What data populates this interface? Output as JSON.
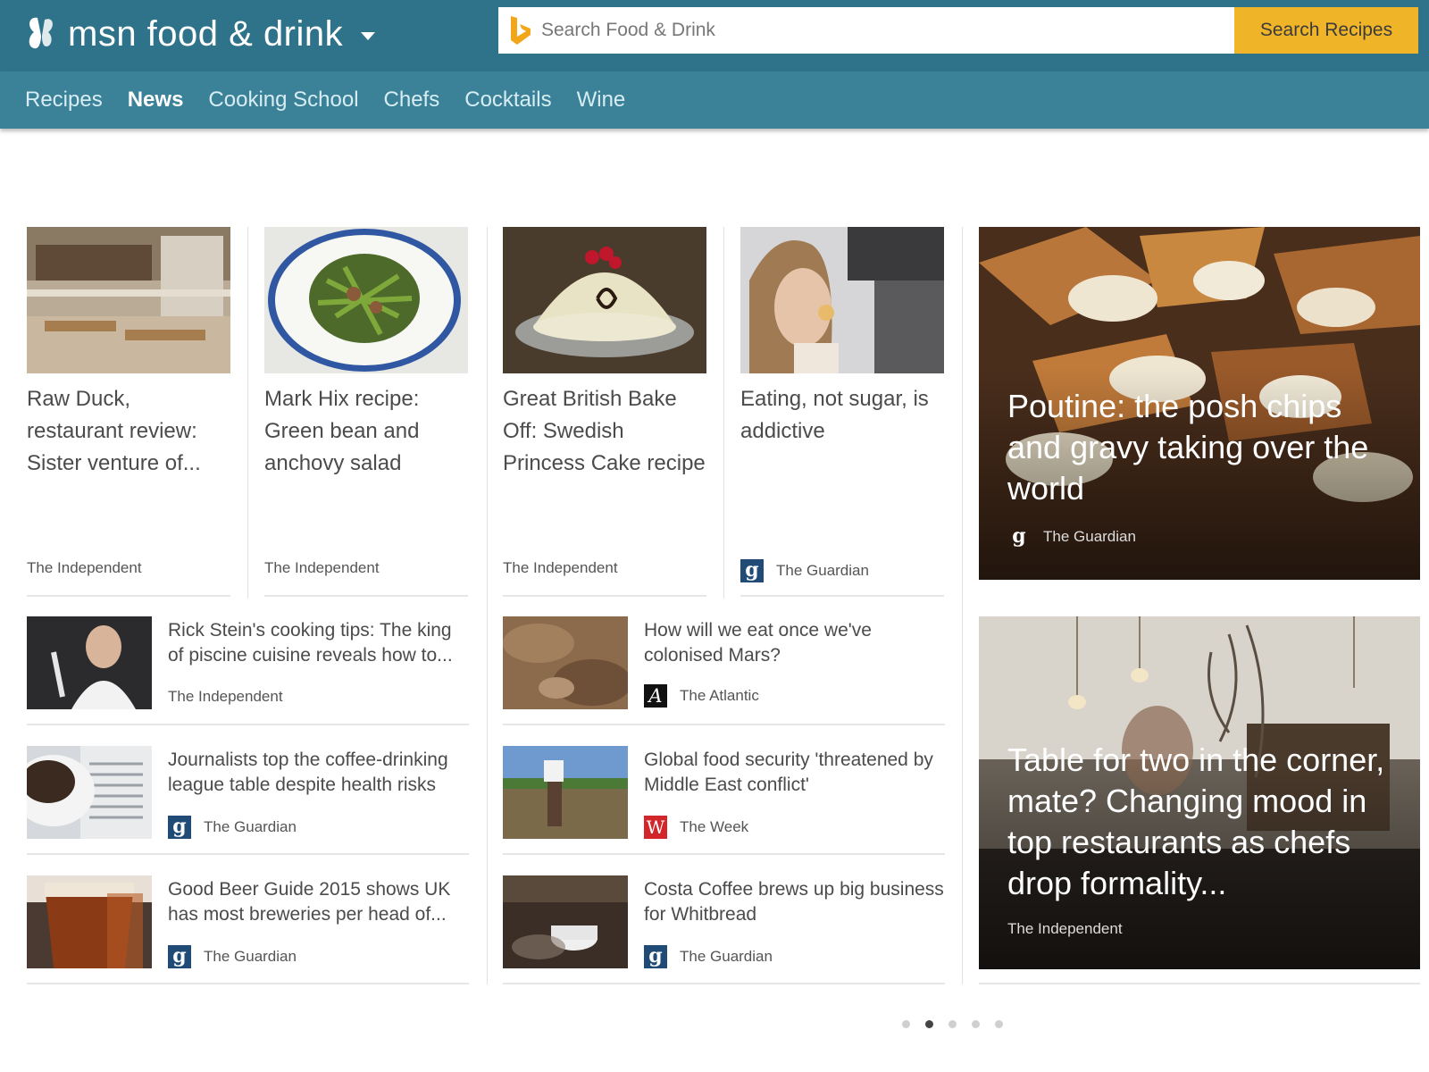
{
  "header": {
    "brand": "msn food & drink",
    "search_placeholder": "Search Food & Drink",
    "search_button": "Search Recipes"
  },
  "nav": {
    "items": [
      {
        "label": "Recipes",
        "active": false
      },
      {
        "label": "News",
        "active": true
      },
      {
        "label": "Cooking School",
        "active": false
      },
      {
        "label": "Chefs",
        "active": false
      },
      {
        "label": "Cocktails",
        "active": false
      },
      {
        "label": "Wine",
        "active": false
      }
    ]
  },
  "top_cards": [
    {
      "title": "Raw Duck, restaurant review: Sister venture of...",
      "source": "The Independent",
      "source_logo": ""
    },
    {
      "title": "Mark Hix recipe: Green bean and anchovy salad",
      "source": "The Independent",
      "source_logo": ""
    },
    {
      "title": "Great British Bake Off: Swedish Princess Cake recipe",
      "source": "The Independent",
      "source_logo": ""
    },
    {
      "title": "Eating, not sugar, is addictive",
      "source": "The Guardian",
      "source_logo": "g"
    }
  ],
  "left_list": [
    {
      "title": "Rick Stein's cooking tips: The king of piscine cuisine reveals how to...",
      "source": "The Independent",
      "source_logo": ""
    },
    {
      "title": "Journalists top the coffee-drinking league table despite health risks",
      "source": "The Guardian",
      "source_logo": "g"
    },
    {
      "title": "Good Beer Guide 2015 shows UK has most breweries per head of...",
      "source": "The Guardian",
      "source_logo": "g"
    }
  ],
  "mid_list": [
    {
      "title": "How will we eat once we've colonised Mars?",
      "source": "The Atlantic",
      "source_logo": "A"
    },
    {
      "title": "Global food security 'threatened by Middle East conflict'",
      "source": "The Week",
      "source_logo": "W"
    },
    {
      "title": "Costa Coffee brews up big business for Whitbread",
      "source": "The Guardian",
      "source_logo": "g"
    }
  ],
  "features": [
    {
      "title": "Poutine: the posh chips and gravy taking over the world",
      "source": "The Guardian",
      "source_logo": "g"
    },
    {
      "title": "Table for two in the corner, mate? Changing mood in top restaurants as chefs drop formality...",
      "source": "The Independent",
      "source_logo": ""
    }
  ],
  "pagination": {
    "count": 5,
    "active_index": 1
  },
  "colors": {
    "header": "#2e7389",
    "nav": "#3b8299",
    "search_button": "#f0b429",
    "guardian": "#1f4b76"
  }
}
